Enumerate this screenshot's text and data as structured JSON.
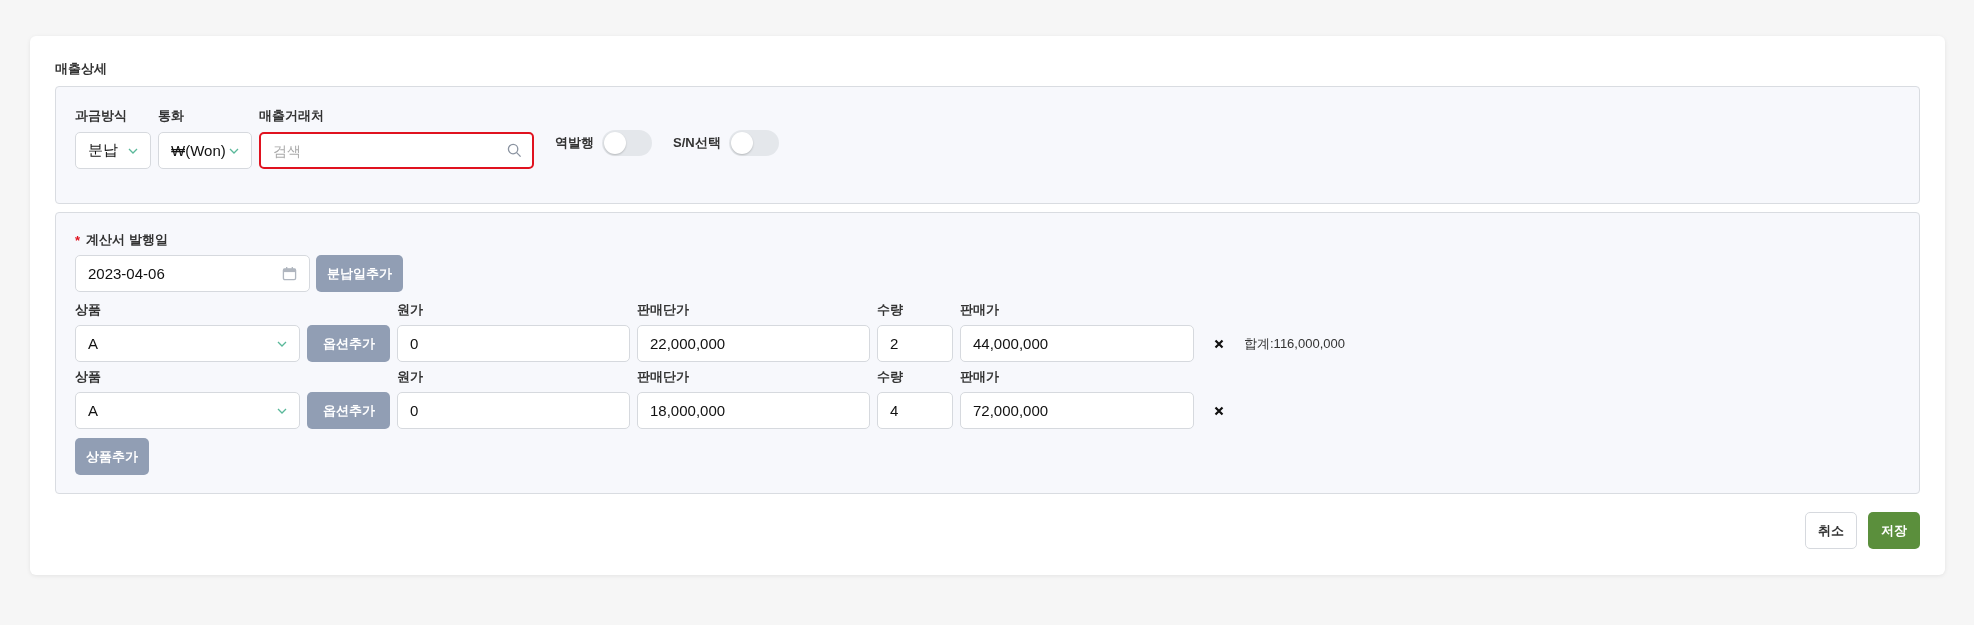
{
  "section_title": "매출상세",
  "billing": {
    "method": {
      "label": "과금방식",
      "value": "분납"
    },
    "currency": {
      "label": "통화",
      "value": "₩(Won)"
    },
    "customer": {
      "label": "매출거래처",
      "placeholder": "검색",
      "invalid": true
    },
    "toggles": [
      {
        "label": "역발행",
        "on": false
      },
      {
        "label": "S/N선택",
        "on": false
      }
    ]
  },
  "invoice": {
    "required_mark": "*",
    "label": "계산서 발행일",
    "date": "2023-04-06",
    "add_button": "분납일추가"
  },
  "products": [
    {
      "product_label": "상품",
      "product": "A",
      "option_button": "옵션추가",
      "cost_label": "원가",
      "cost": "0",
      "unit_price_label": "판매단가",
      "unit_price": "22,000,000",
      "quantity_label": "수량",
      "quantity": "2",
      "sale_price_label": "판매가",
      "sale_price": "44,000,000",
      "total": "합계:116,000,000"
    },
    {
      "product_label": "상품",
      "product": "A",
      "option_button": "옵션추가",
      "cost_label": "원가",
      "cost": "0",
      "unit_price_label": "판매단가",
      "unit_price": "18,000,000",
      "quantity_label": "수량",
      "quantity": "4",
      "sale_price_label": "판매가",
      "sale_price": "72,000,000"
    }
  ],
  "add_product_button": "상품추가",
  "buttons": {
    "cancel": "취소",
    "save": "저장"
  }
}
